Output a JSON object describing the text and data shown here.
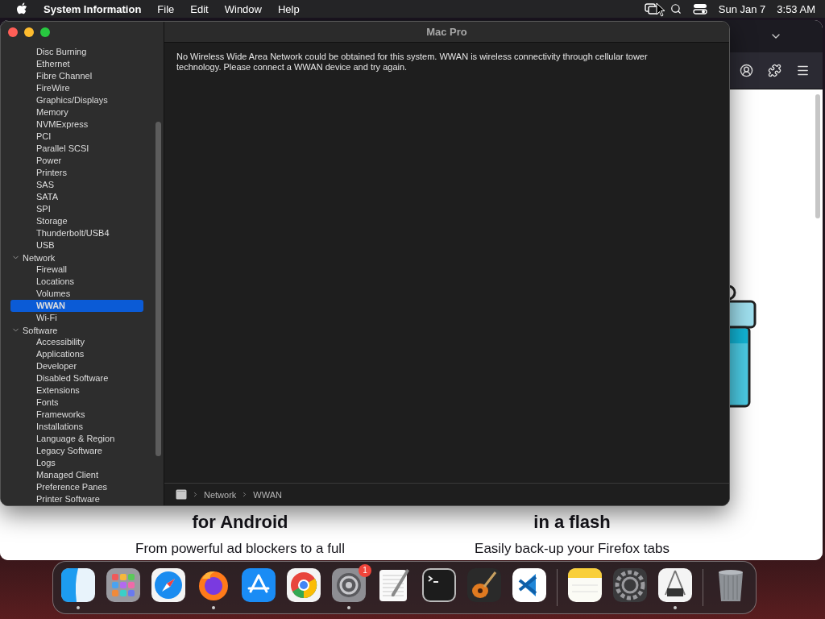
{
  "menu_bar": {
    "app_name": "System Information",
    "menus": [
      "File",
      "Edit",
      "Window",
      "Help"
    ],
    "date": "Sun Jan 7",
    "time": "3:53 AM"
  },
  "browser": {
    "columns": [
      {
        "heading": "for Android",
        "text": "From powerful ad blockers to a full"
      },
      {
        "heading": "in a flash",
        "text": "Easily back-up your Firefox tabs"
      }
    ]
  },
  "window": {
    "title": "Mac Pro",
    "sidebar": {
      "sections": [
        {
          "children": [
            {
              "label": "Disc Burning",
              "selected": false
            },
            {
              "label": "Ethernet",
              "selected": false
            },
            {
              "label": "Fibre Channel",
              "selected": false
            },
            {
              "label": "FireWire",
              "selected": false
            },
            {
              "label": "Graphics/Displays",
              "selected": false
            },
            {
              "label": "Memory",
              "selected": false
            },
            {
              "label": "NVMExpress",
              "selected": false
            },
            {
              "label": "PCI",
              "selected": false
            },
            {
              "label": "Parallel SCSI",
              "selected": false
            },
            {
              "label": "Power",
              "selected": false
            },
            {
              "label": "Printers",
              "selected": false
            },
            {
              "label": "SAS",
              "selected": false
            },
            {
              "label": "SATA",
              "selected": false
            },
            {
              "label": "SPI",
              "selected": false
            },
            {
              "label": "Storage",
              "selected": false
            },
            {
              "label": "Thunderbolt/USB4",
              "selected": false
            },
            {
              "label": "USB",
              "selected": false
            }
          ]
        },
        {
          "label": "Network",
          "expanded": true,
          "children": [
            {
              "label": "Firewall",
              "selected": false
            },
            {
              "label": "Locations",
              "selected": false
            },
            {
              "label": "Volumes",
              "selected": false
            },
            {
              "label": "WWAN",
              "selected": true
            },
            {
              "label": "Wi-Fi",
              "selected": false
            }
          ]
        },
        {
          "label": "Software",
          "expanded": true,
          "children": [
            {
              "label": "Accessibility",
              "selected": false
            },
            {
              "label": "Applications",
              "selected": false
            },
            {
              "label": "Developer",
              "selected": false
            },
            {
              "label": "Disabled Software",
              "selected": false
            },
            {
              "label": "Extensions",
              "selected": false
            },
            {
              "label": "Fonts",
              "selected": false
            },
            {
              "label": "Frameworks",
              "selected": false
            },
            {
              "label": "Installations",
              "selected": false
            },
            {
              "label": "Language & Region",
              "selected": false
            },
            {
              "label": "Legacy Software",
              "selected": false
            },
            {
              "label": "Logs",
              "selected": false
            },
            {
              "label": "Managed Client",
              "selected": false
            },
            {
              "label": "Preference Panes",
              "selected": false
            },
            {
              "label": "Printer Software",
              "selected": false
            }
          ]
        }
      ]
    },
    "message": "No Wireless Wide Area Network could be obtained for this system. WWAN is wireless connectivity through cellular tower technology. Please connect a WWAN device and try again.",
    "path_bar": [
      "Network",
      "WWAN"
    ]
  },
  "dock": {
    "groups": [
      {
        "apps": [
          {
            "kind": "finder",
            "running": true
          },
          {
            "kind": "launchpad",
            "running": false
          },
          {
            "kind": "safari",
            "running": false
          },
          {
            "kind": "firefox",
            "running": true
          },
          {
            "kind": "appstore",
            "running": false
          },
          {
            "kind": "chrome",
            "running": false
          },
          {
            "kind": "settings",
            "running": true,
            "badge": "1"
          },
          {
            "kind": "textedit",
            "running": false
          },
          {
            "kind": "terminal",
            "running": false
          },
          {
            "kind": "garageband",
            "running": false
          },
          {
            "kind": "vscode",
            "running": false
          }
        ]
      },
      {
        "apps": [
          {
            "kind": "notes",
            "running": false
          },
          {
            "kind": "utility",
            "running": false
          },
          {
            "kind": "sysinfo",
            "running": true
          }
        ]
      },
      {
        "apps": [
          {
            "kind": "trash",
            "running": false
          }
        ]
      }
    ]
  }
}
